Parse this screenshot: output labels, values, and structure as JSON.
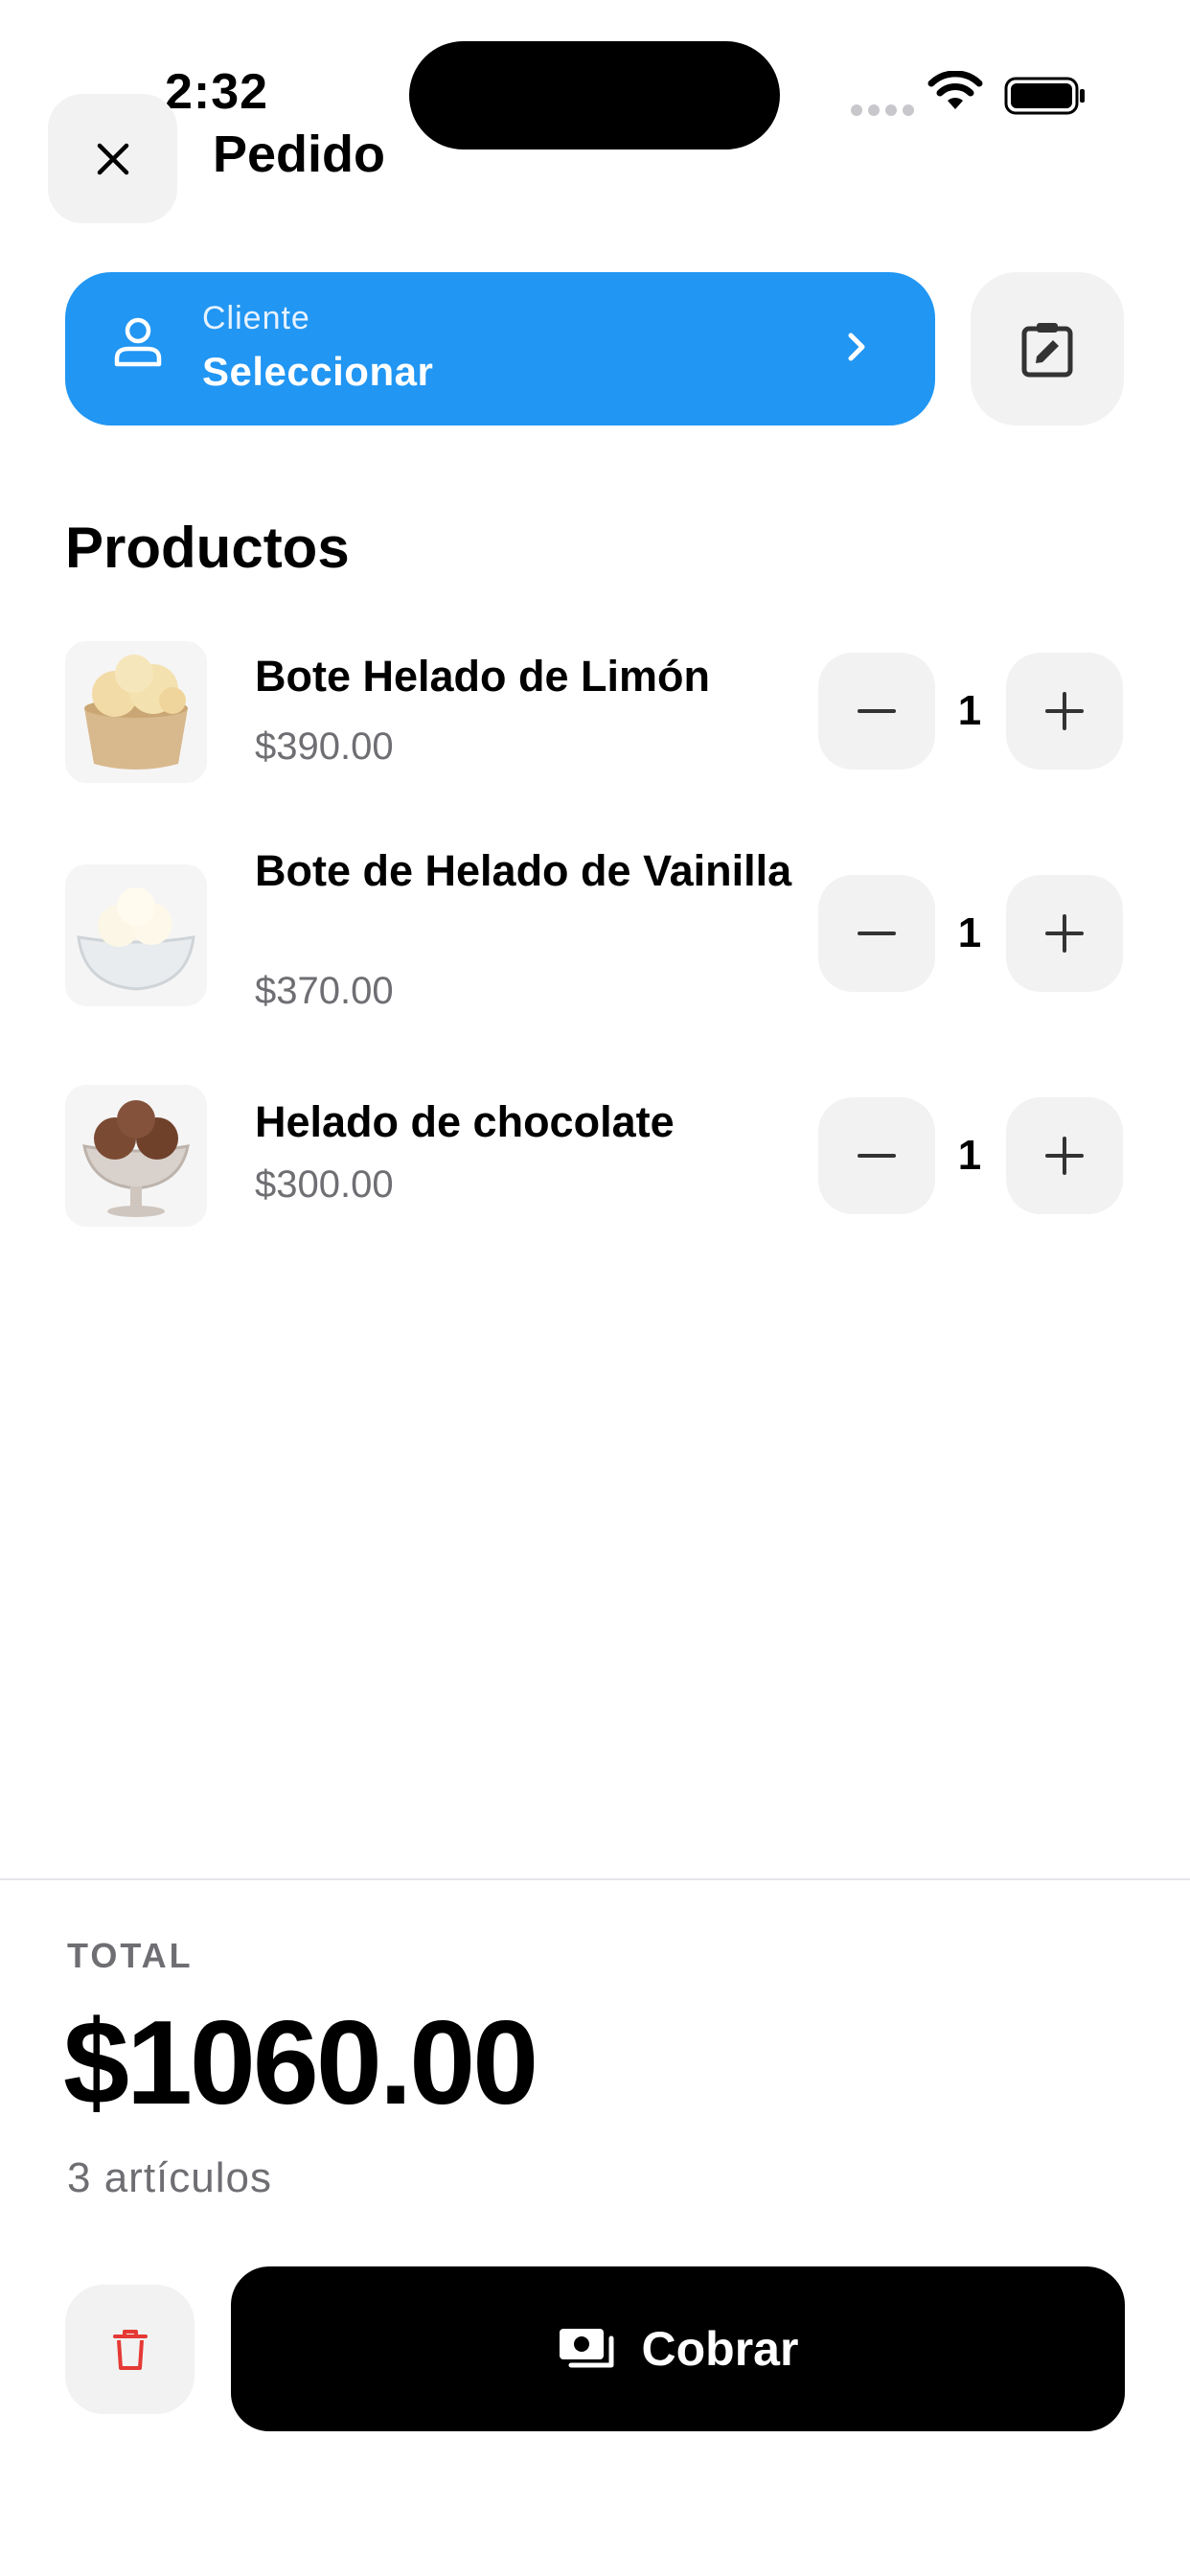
{
  "status_bar": {
    "time": "2:32"
  },
  "header": {
    "title": "Pedido"
  },
  "client": {
    "label": "Cliente",
    "value": "Seleccionar"
  },
  "section_title": "Productos",
  "products": [
    {
      "name": "Bote Helado de Limón",
      "price": "$390.00",
      "qty": "1"
    },
    {
      "name": "Bote de Helado de Vainilla",
      "price": "$370.00",
      "qty": "1"
    },
    {
      "name": "Helado de chocolate",
      "price": "$300.00",
      "qty": "1"
    }
  ],
  "summary": {
    "total_label": "TOTAL",
    "total_value": "$1060.00",
    "items_count": "3 artículos"
  },
  "actions": {
    "charge_label": "Cobrar"
  },
  "colors": {
    "accent": "#2196f3",
    "danger": "#e53935",
    "button_bg": "#f2f2f2"
  },
  "icons": [
    "close-icon",
    "user-icon",
    "chevron-right-icon",
    "edit-note-icon",
    "minus-icon",
    "plus-icon",
    "trash-icon",
    "cash-icon",
    "wifi-icon",
    "battery-icon"
  ]
}
